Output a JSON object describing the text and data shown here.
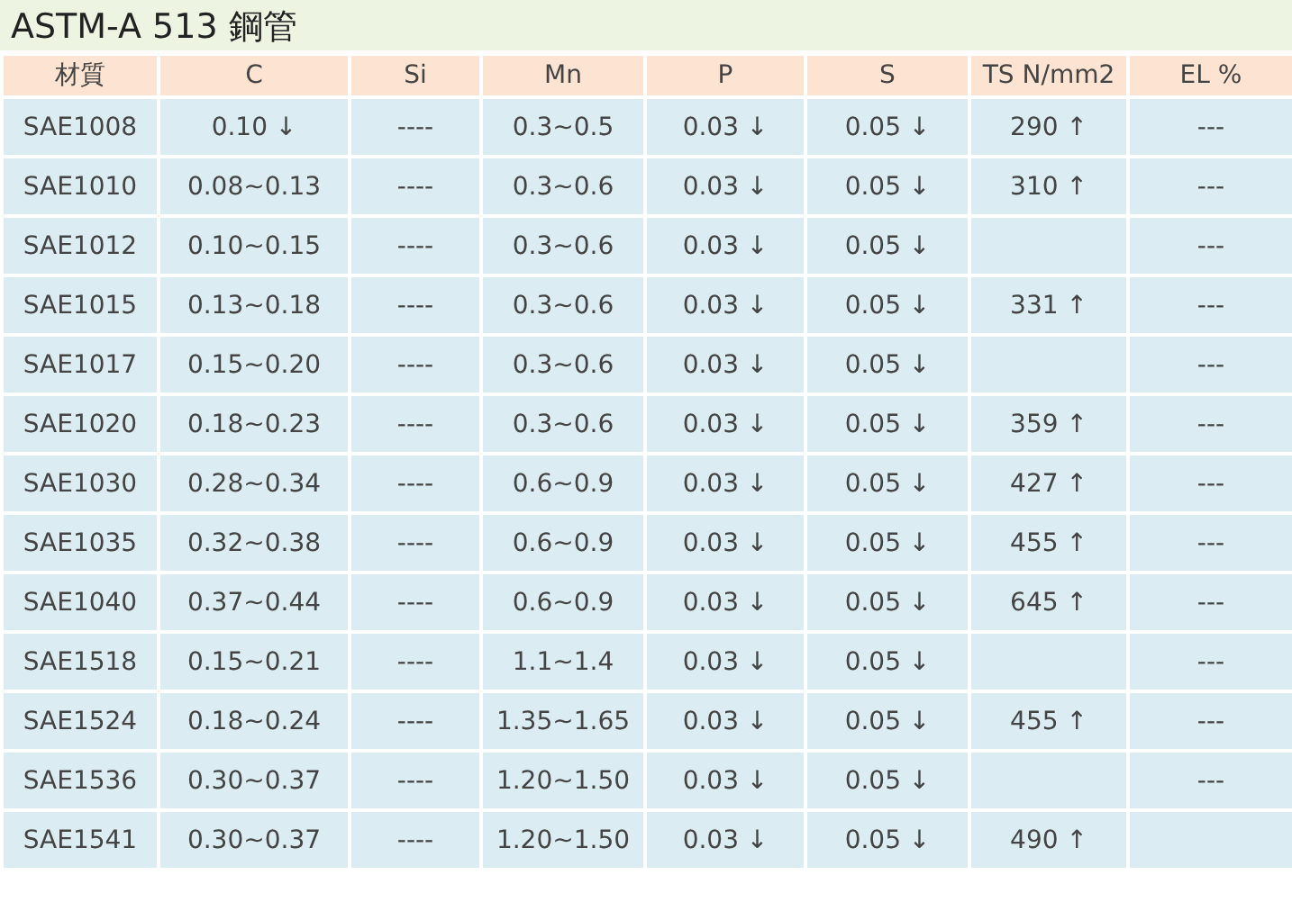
{
  "title": "ASTM-A 513 鋼管",
  "table": {
    "columns": [
      "材質",
      "C",
      "Si",
      "Mn",
      "P",
      "S",
      "TS N/mm2",
      "EL %"
    ],
    "rows": [
      [
        "SAE1008",
        "0.10 ↓",
        "----",
        "0.3~0.5",
        "0.03 ↓",
        "0.05 ↓",
        "290 ↑",
        "---"
      ],
      [
        "SAE1010",
        "0.08~0.13",
        "----",
        "0.3~0.6",
        "0.03 ↓",
        "0.05 ↓",
        "310 ↑",
        "---"
      ],
      [
        "SAE1012",
        "0.10~0.15",
        "----",
        "0.3~0.6",
        "0.03 ↓",
        "0.05 ↓",
        null,
        "---"
      ],
      [
        "SAE1015",
        "0.13~0.18",
        "----",
        "0.3~0.6",
        "0.03 ↓",
        "0.05 ↓",
        "331 ↑",
        "---"
      ],
      [
        "SAE1017",
        "0.15~0.20",
        "----",
        "0.3~0.6",
        "0.03 ↓",
        "0.05 ↓",
        null,
        "---"
      ],
      [
        "SAE1020",
        "0.18~0.23",
        "----",
        "0.3~0.6",
        "0.03 ↓",
        "0.05 ↓",
        "359 ↑",
        "---"
      ],
      [
        "SAE1030",
        "0.28~0.34",
        "----",
        "0.6~0.9",
        "0.03 ↓",
        "0.05 ↓",
        "427 ↑",
        "---"
      ],
      [
        "SAE1035",
        "0.32~0.38",
        "----",
        "0.6~0.9",
        "0.03 ↓",
        "0.05 ↓",
        "455 ↑",
        "---"
      ],
      [
        "SAE1040",
        "0.37~0.44",
        "----",
        "0.6~0.9",
        "0.03 ↓",
        "0.05 ↓",
        "645 ↑",
        "---"
      ],
      [
        "SAE1518",
        "0.15~0.21",
        "----",
        "1.1~1.4",
        "0.03 ↓",
        "0.05 ↓",
        null,
        "---"
      ],
      [
        "SAE1524",
        "0.18~0.24",
        "----",
        "1.35~1.65",
        "0.03 ↓",
        "0.05 ↓",
        "455 ↑",
        "---"
      ],
      [
        "SAE1536",
        "0.30~0.37",
        "----",
        "1.20~1.50",
        "0.03 ↓",
        "0.05 ↓",
        null,
        "---"
      ],
      [
        "SAE1541",
        "0.30~0.37",
        "----",
        "1.20~1.50",
        "0.03 ↓",
        "0.05 ↓",
        "490 ↑",
        null
      ]
    ]
  }
}
